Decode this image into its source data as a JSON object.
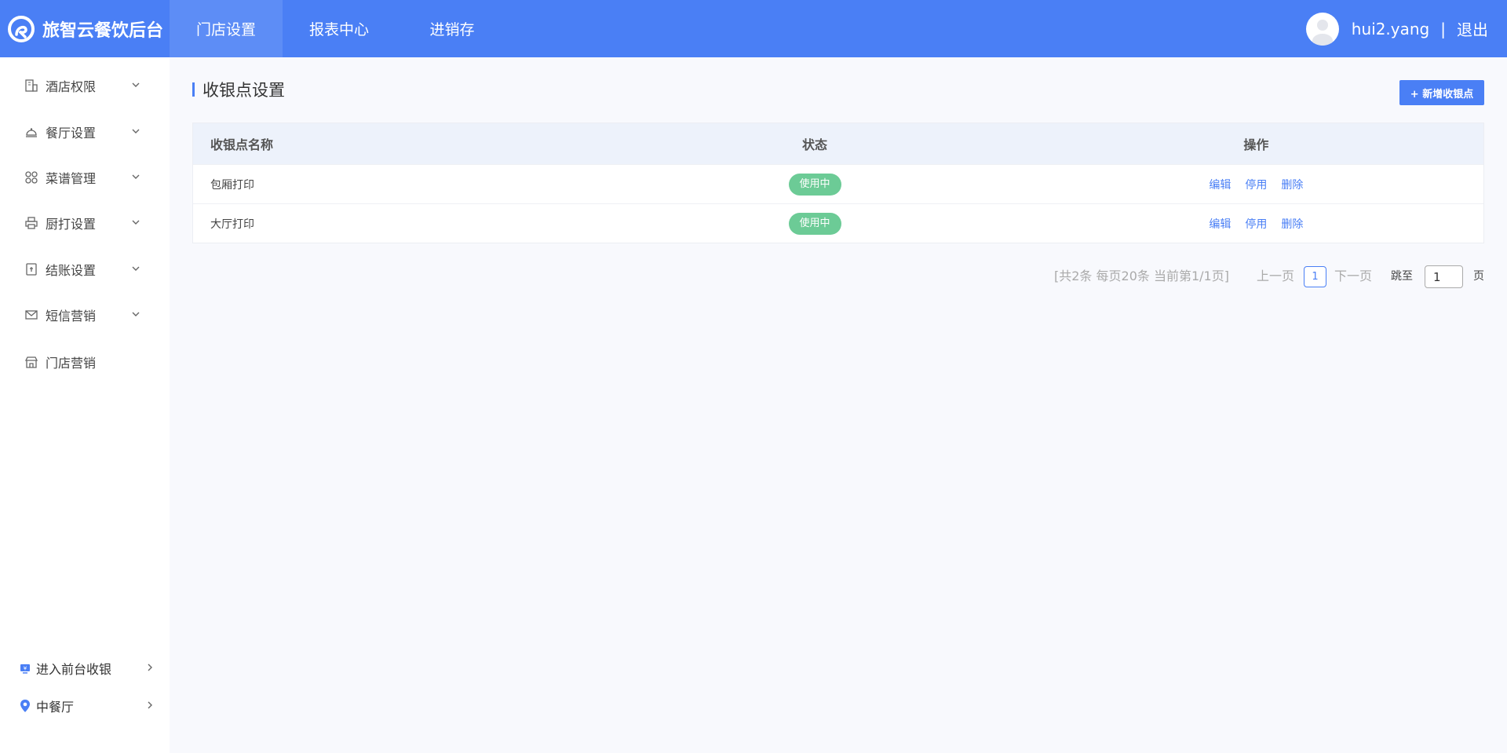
{
  "header": {
    "brand_title": "旅智云餐饮后台",
    "nav": [
      {
        "label": "门店设置",
        "active": true
      },
      {
        "label": "报表中心",
        "active": false
      },
      {
        "label": "进销存",
        "active": false
      }
    ],
    "username": "hui2.yang",
    "separator": "|",
    "logout": "退出"
  },
  "sidebar": {
    "items": [
      {
        "label": "酒店权限",
        "icon": "building-icon"
      },
      {
        "label": "餐厅设置",
        "icon": "cloche-icon"
      },
      {
        "label": "菜谱管理",
        "icon": "grid-icon"
      },
      {
        "label": "厨打设置",
        "icon": "printer-icon"
      },
      {
        "label": "结账设置",
        "icon": "checkout-icon"
      },
      {
        "label": "短信营销",
        "icon": "mail-icon"
      },
      {
        "label": "门店营销",
        "icon": "store-icon"
      }
    ],
    "bottom": [
      {
        "label": "进入前台收银",
        "icon": "cashier-icon"
      },
      {
        "label": "中餐厅",
        "icon": "location-pin-icon"
      }
    ]
  },
  "main": {
    "title": "收银点设置",
    "add_button": "+ 新增收银点",
    "table": {
      "headers": [
        "收银点名称",
        "状态",
        "操作"
      ],
      "rows": [
        {
          "name": "包厢打印",
          "status": "使用中",
          "ops": [
            "编辑",
            "停用",
            "删除"
          ]
        },
        {
          "name": "大厅打印",
          "status": "使用中",
          "ops": [
            "编辑",
            "停用",
            "删除"
          ]
        }
      ]
    },
    "pagination": {
      "info": "[共2条 每页20条 当前第1/1页]",
      "prev": "上一页",
      "current": "1",
      "next": "下一页",
      "jump_label": "跳至",
      "jump_value": "1",
      "page_suffix": "页"
    }
  },
  "colors": {
    "primary": "#4a7ff5",
    "nav_active": "#5d8df6",
    "badge": "#6ccb96",
    "table_header": "#edf2fb",
    "page_bg": "#f8f9fd"
  }
}
